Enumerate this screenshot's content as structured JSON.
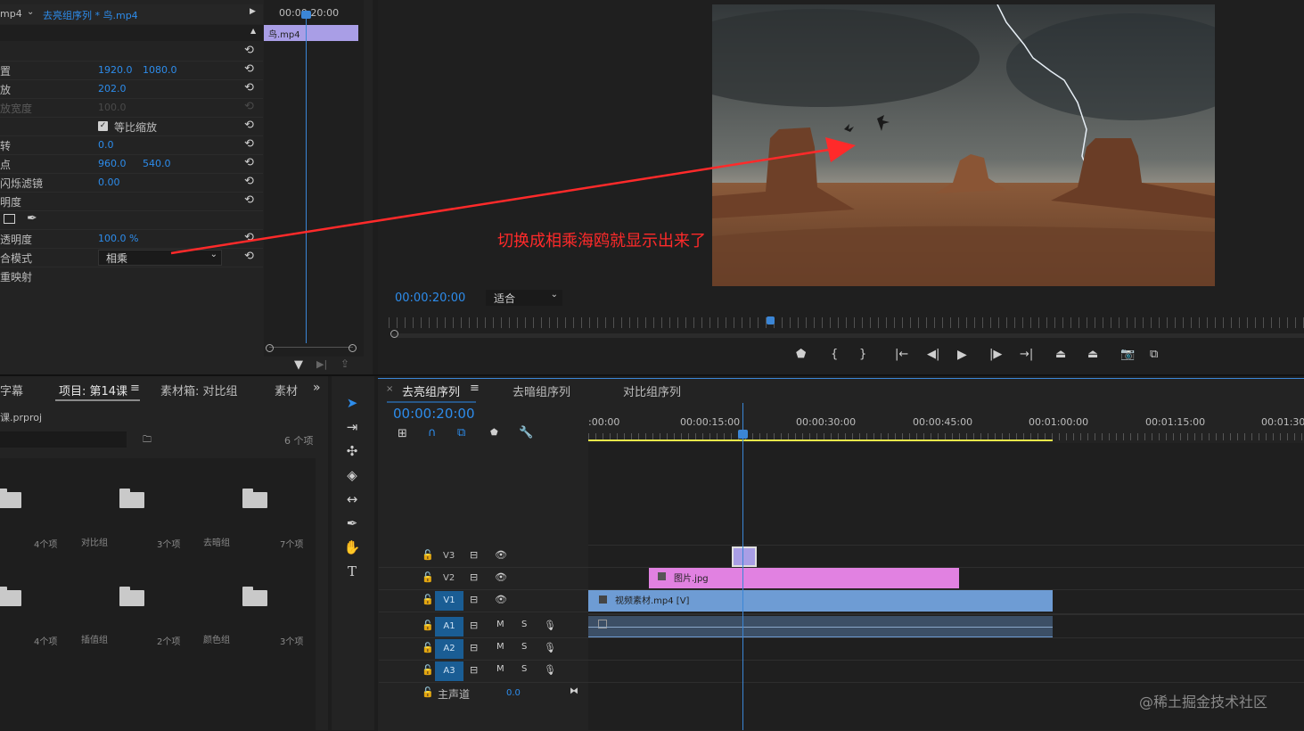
{
  "effect_controls": {
    "header_left": "mp4",
    "header_seq": "去亮组序列 * 鸟.mp4",
    "timecode": "00:00:20:00",
    "clip_label": "鸟.mp4",
    "rows": [
      {
        "label": "",
        "v1": "",
        "v2": ""
      },
      {
        "label": "置",
        "v1": "1920.0",
        "v2": "1080.0"
      },
      {
        "label": "放",
        "v1": "202.0",
        "v2": ""
      },
      {
        "label": "放宽度",
        "v1": "100.0",
        "v2": ""
      },
      {
        "label": "",
        "checkbox": "等比缩放"
      },
      {
        "label": "转",
        "v1": "0.0",
        "v2": ""
      },
      {
        "label": "点",
        "v1": "960.0",
        "v2": "540.0"
      },
      {
        "label": "闪烁滤镜",
        "v1": "0.00",
        "v2": ""
      },
      {
        "label": "明度",
        "v1": "",
        "v2": ""
      },
      {
        "label": "",
        "v1": "",
        "v2": ""
      },
      {
        "label": "透明度",
        "v1": "100.0 %",
        "v2": ""
      },
      {
        "label": "合模式",
        "select": "相乘"
      },
      {
        "label": "重映射",
        "v1": "",
        "v2": ""
      }
    ]
  },
  "program_monitor": {
    "annotation": "切换成相乘海鸥就显示出来了",
    "timecode": "00:00:20:00",
    "zoom": "适合"
  },
  "project_panel": {
    "tabs": [
      "字幕",
      "项目: 第14课",
      "素材箱: 对比组",
      "素材"
    ],
    "project_file": "课.prproj",
    "item_count": "6 个项",
    "bins": [
      {
        "count": "4个项",
        "name": ""
      },
      {
        "count": "3个项",
        "name": "对比组"
      },
      {
        "count": "7个项",
        "name": "去暗组"
      },
      {
        "count": "4个项",
        "name": ""
      },
      {
        "count": "2个项",
        "name": "插值组"
      },
      {
        "count": "3个项",
        "name": "颜色组"
      }
    ]
  },
  "timeline": {
    "tabs": [
      "去亮组序列",
      "去暗组序列",
      "对比组序列"
    ],
    "timecode": "00:00:20:00",
    "ruler": [
      ":00:00",
      "00:00:15:00",
      "00:00:30:00",
      "00:00:45:00",
      "00:01:00:00",
      "00:01:15:00",
      "00:01:30:0"
    ],
    "tracks": {
      "v3": "V3",
      "v2": "V2",
      "v1": "V1",
      "a1": "A1",
      "a2": "A2",
      "a3": "A3",
      "master": "主声道",
      "master_value": "0.0",
      "m": "M",
      "s": "S"
    },
    "clips": {
      "image": "图片.jpg",
      "video": "视频素材.mp4 [V]"
    }
  },
  "watermark": "@稀土掘金技术社区",
  "colors": {
    "accent_blue": "#2d8ceb",
    "clip_pink": "#e181e1",
    "clip_video": "#6e9cd4",
    "clip_purple": "#a99ee6",
    "annotation_red": "#ff2a2a",
    "playhead": "#3b86d6"
  }
}
